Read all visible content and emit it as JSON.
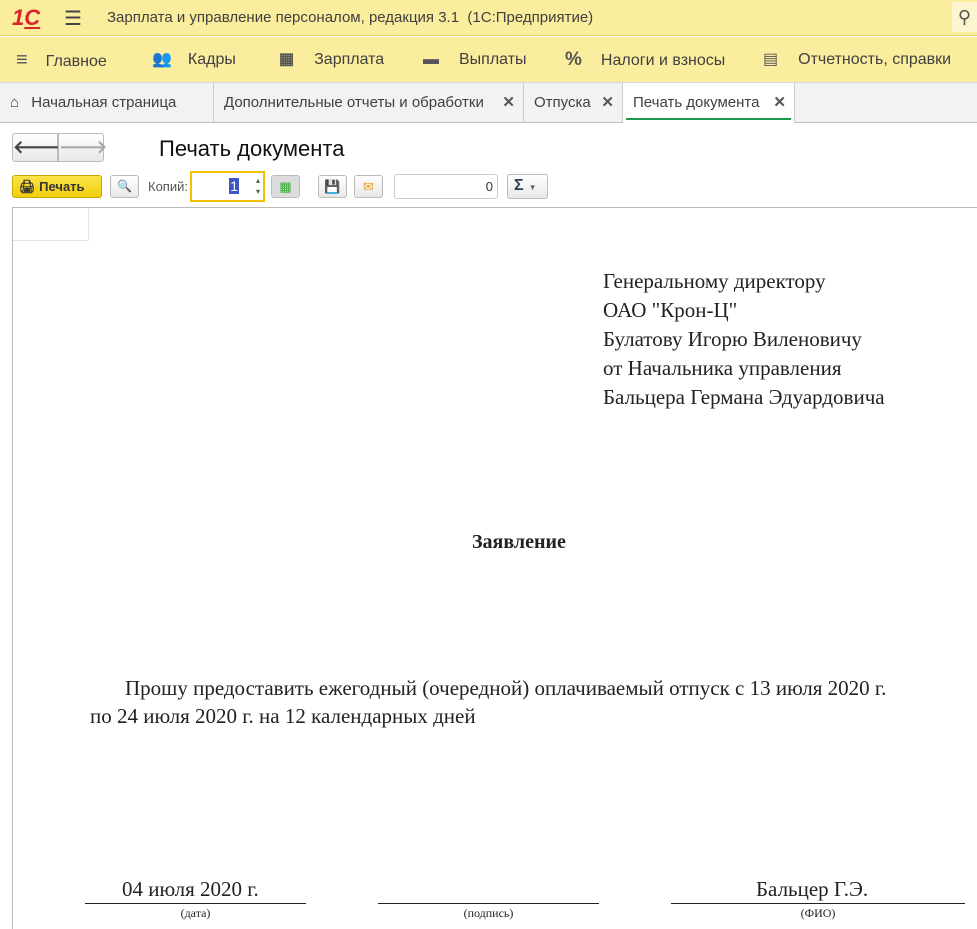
{
  "app": {
    "title": "Зарплата и управление персоналом, редакция 3.1  (1С:Предприятие)",
    "logo": "1С"
  },
  "menu": [
    {
      "label": "Главное",
      "icon": "hamburger-icon"
    },
    {
      "label": "Кадры",
      "icon": "people-icon"
    },
    {
      "label": "Зарплата",
      "icon": "calculator-icon"
    },
    {
      "label": "Выплаты",
      "icon": "wallet-icon"
    },
    {
      "label": "Налоги и взносы",
      "icon": "percent-icon"
    },
    {
      "label": "Отчетность, справки",
      "icon": "reports-icon"
    }
  ],
  "tabs": [
    {
      "label": "Начальная страница"
    },
    {
      "label": "Дополнительные отчеты и обработки"
    },
    {
      "label": "Отпуска"
    },
    {
      "label": "Печать документа",
      "active": true
    }
  ],
  "form": {
    "title": "Печать документа",
    "print_label": "Печать",
    "copies_label": "Копий:",
    "copies_value": "1",
    "sum_value": "0",
    "sum_symbol": "Σ"
  },
  "document": {
    "address": [
      "Генеральному директору",
      "ОАО \"Крон-Ц\"",
      "Булатову Игорю Виленовичу",
      "от Начальника управления",
      "Бальцера Германа Эдуардовича"
    ],
    "heading": "Заявление",
    "body_line1": "Прошу предоставить ежегодный (очередной) оплачиваемый отпуск с 13 июля 2020 г.",
    "body_line2": "по 24 июля 2020 г. на 12 календарных дней",
    "date": "04 июля 2020 г.",
    "date_label": "(дата)",
    "signature_label": "(подпись)",
    "name": "Бальцер Г.Э.",
    "name_label": "(ФИО)"
  },
  "colors": {
    "accent": "#1a9a4a",
    "yellow": "#fbed9e",
    "logo": "#d9242b"
  }
}
